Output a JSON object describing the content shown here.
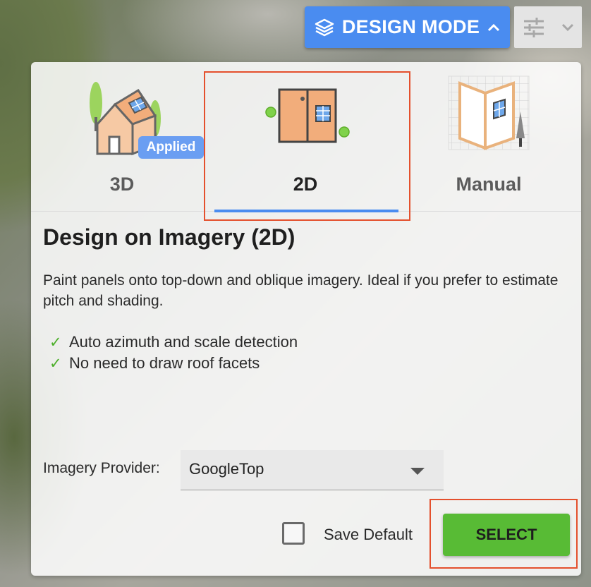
{
  "header": {
    "mode_button_label": "DESIGN MODE",
    "mode_icon": "layers-icon",
    "mode_chevron": "chevron-up-icon",
    "filter_icon": "sliders-icon",
    "filter_chevron": "chevron-down-icon"
  },
  "tabs": [
    {
      "label": "3D",
      "badge": "Applied",
      "icon": "house-3d-icon",
      "active": false
    },
    {
      "label": "2D",
      "icon": "panel-2d-icon",
      "active": true
    },
    {
      "label": "Manual",
      "icon": "manual-grid-icon",
      "active": false
    }
  ],
  "content": {
    "title": "Design on Imagery (2D)",
    "description": "Paint panels onto top-down and oblique imagery. Ideal if you prefer to estimate pitch and shading.",
    "features": [
      "Auto azimuth and scale detection",
      "No need to draw roof facets"
    ],
    "check_glyph": "✓"
  },
  "imagery": {
    "label": "Imagery Provider:",
    "value": "GoogleTop"
  },
  "footer": {
    "save_default_label": "Save Default",
    "save_default_checked": false,
    "select_label": "SELECT"
  },
  "colors": {
    "accent_blue": "#4a8cf0",
    "select_green": "#58bb35",
    "highlight_red": "#e4502d",
    "check_green": "#4caf2a"
  }
}
